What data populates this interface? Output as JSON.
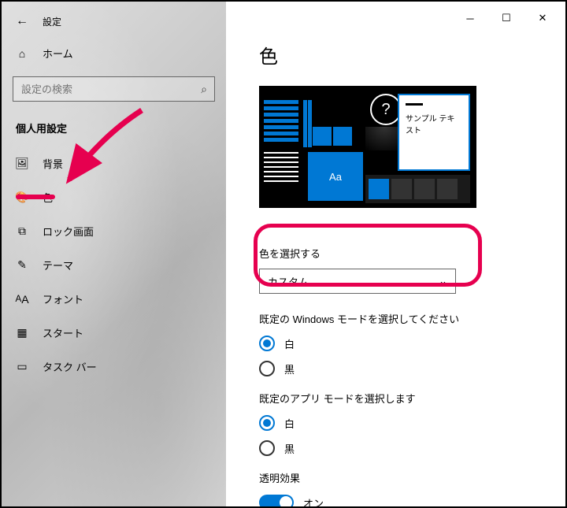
{
  "window": {
    "title": "設定"
  },
  "home": {
    "label": "ホーム"
  },
  "search": {
    "placeholder": "設定の検索"
  },
  "section": {
    "label": "個人用設定"
  },
  "nav": [
    {
      "id": "background",
      "label": "背景"
    },
    {
      "id": "colors",
      "label": "色"
    },
    {
      "id": "lockscreen",
      "label": "ロック画面"
    },
    {
      "id": "themes",
      "label": "テーマ"
    },
    {
      "id": "fonts",
      "label": "フォント"
    },
    {
      "id": "start",
      "label": "スタート"
    },
    {
      "id": "taskbar",
      "label": "タスク バー"
    }
  ],
  "page": {
    "title": "色",
    "preview": {
      "sample_text": "サンプル テキスト",
      "tile_text": "Aa"
    },
    "choose_color": {
      "label": "色を選択する",
      "value": "カスタム"
    },
    "windows_mode": {
      "label": "既定の Windows モードを選択してください",
      "options": [
        "白",
        "黒"
      ],
      "selected": "白"
    },
    "app_mode": {
      "label": "既定のアプリ モードを選択します",
      "options": [
        "白",
        "黒"
      ],
      "selected": "白"
    },
    "transparency": {
      "label": "透明効果",
      "state": "オン"
    }
  },
  "colors": {
    "accent": "#0078d4",
    "highlight": "#e6004f"
  }
}
